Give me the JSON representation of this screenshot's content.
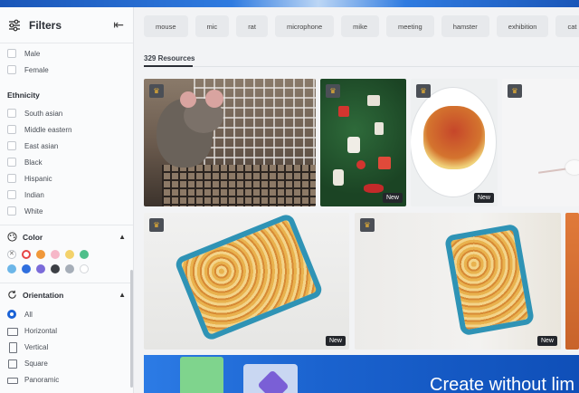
{
  "sidebar": {
    "title": "Filters",
    "gender_options": [
      "Male",
      "Female"
    ],
    "ethnicity": {
      "title": "Ethnicity",
      "options": [
        "South asian",
        "Middle eastern",
        "East asian",
        "Black",
        "Hispanic",
        "Indian",
        "White"
      ]
    },
    "color": {
      "title": "Color",
      "swatches": [
        "none",
        "#e64545",
        "#f0983a",
        "#f6b7c8",
        "#f3d26b",
        "#4fbf8b",
        "#6cb6e8",
        "#2f6fde",
        "#7b6bd9",
        "#3c3f45",
        "#a6aeb8",
        "#ffffff"
      ]
    },
    "orientation": {
      "title": "Orientation",
      "options": [
        "All",
        "Horizontal",
        "Vertical",
        "Square",
        "Panoramic"
      ],
      "selected": "All"
    }
  },
  "tags": [
    "mouse",
    "mic",
    "rat",
    "microphone",
    "mike",
    "meeting",
    "hamster",
    "exhibition",
    "cat"
  ],
  "results": {
    "count_label": "329 Resources"
  },
  "tiles": {
    "new_label": "New"
  },
  "banner": {
    "text": "Create without lim"
  }
}
